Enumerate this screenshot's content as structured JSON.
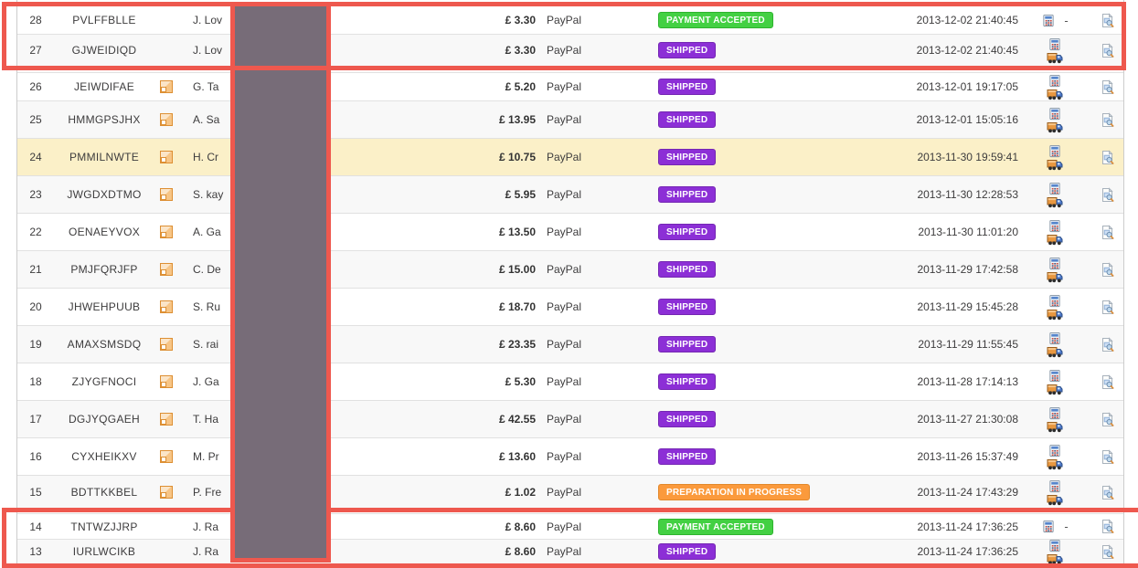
{
  "rows": [
    {
      "id": "28",
      "reference": "PVLFFBLLE",
      "new_client": false,
      "customer": "J. Lov",
      "total": "£ 3.30",
      "payment": "PayPal",
      "status": "PAYMENT ACCEPTED",
      "status_key": "accepted",
      "date": "2013-12-02 21:40:45",
      "delivery": false,
      "highlighted": false
    },
    {
      "id": "27",
      "reference": "GJWEIDIQD",
      "new_client": false,
      "customer": "J. Lov",
      "total": "£ 3.30",
      "payment": "PayPal",
      "status": "SHIPPED",
      "status_key": "shipped",
      "date": "2013-12-02 21:40:45",
      "delivery": true,
      "highlighted": false
    },
    {
      "id": "26",
      "reference": "JEIWDIFAE",
      "new_client": true,
      "customer": "G. Ta",
      "total": "£ 5.20",
      "payment": "PayPal",
      "status": "SHIPPED",
      "status_key": "shipped",
      "date": "2013-12-01 19:17:05",
      "delivery": true,
      "highlighted": false
    },
    {
      "id": "25",
      "reference": "HMMGPSJHX",
      "new_client": true,
      "customer": "A. Sa",
      "total": "£ 13.95",
      "payment": "PayPal",
      "status": "SHIPPED",
      "status_key": "shipped",
      "date": "2013-12-01 15:05:16",
      "delivery": true,
      "highlighted": false
    },
    {
      "id": "24",
      "reference": "PMMILNWTE",
      "new_client": true,
      "customer": "H. Cr",
      "total": "£ 10.75",
      "payment": "PayPal",
      "status": "SHIPPED",
      "status_key": "shipped",
      "date": "2013-11-30 19:59:41",
      "delivery": true,
      "highlighted": true
    },
    {
      "id": "23",
      "reference": "JWGDXDTMO",
      "new_client": true,
      "customer": "S. kay",
      "total": "£ 5.95",
      "payment": "PayPal",
      "status": "SHIPPED",
      "status_key": "shipped",
      "date": "2013-11-30 12:28:53",
      "delivery": true,
      "highlighted": false
    },
    {
      "id": "22",
      "reference": "OENAEYVOX",
      "new_client": true,
      "customer": "A. Ga",
      "total": "£ 13.50",
      "payment": "PayPal",
      "status": "SHIPPED",
      "status_key": "shipped",
      "date": "2013-11-30 11:01:20",
      "delivery": true,
      "highlighted": false
    },
    {
      "id": "21",
      "reference": "PMJFQRJFP",
      "new_client": true,
      "customer": "C. De",
      "total": "£ 15.00",
      "payment": "PayPal",
      "status": "SHIPPED",
      "status_key": "shipped",
      "date": "2013-11-29 17:42:58",
      "delivery": true,
      "highlighted": false
    },
    {
      "id": "20",
      "reference": "JHWEHPUUB",
      "new_client": true,
      "customer": "S. Ru",
      "total": "£ 18.70",
      "payment": "PayPal",
      "status": "SHIPPED",
      "status_key": "shipped",
      "date": "2013-11-29 15:45:28",
      "delivery": true,
      "highlighted": false
    },
    {
      "id": "19",
      "reference": "AMAXSMSDQ",
      "new_client": true,
      "customer": "S. rai",
      "total": "£ 23.35",
      "payment": "PayPal",
      "status": "SHIPPED",
      "status_key": "shipped",
      "date": "2013-11-29 11:55:45",
      "delivery": true,
      "highlighted": false
    },
    {
      "id": "18",
      "reference": "ZJYGFNOCI",
      "new_client": true,
      "customer": "J. Ga",
      "total": "£ 5.30",
      "payment": "PayPal",
      "status": "SHIPPED",
      "status_key": "shipped",
      "date": "2013-11-28 17:14:13",
      "delivery": true,
      "highlighted": false
    },
    {
      "id": "17",
      "reference": "DGJYQGAEH",
      "new_client": true,
      "customer": "T. Ha",
      "total": "£ 42.55",
      "payment": "PayPal",
      "status": "SHIPPED",
      "status_key": "shipped",
      "date": "2013-11-27 21:30:08",
      "delivery": true,
      "highlighted": false
    },
    {
      "id": "16",
      "reference": "CYXHEIKXV",
      "new_client": true,
      "customer": "M. Pr",
      "total": "£ 13.60",
      "payment": "PayPal",
      "status": "SHIPPED",
      "status_key": "shipped",
      "date": "2013-11-26 15:37:49",
      "delivery": true,
      "highlighted": false
    },
    {
      "id": "15",
      "reference": "BDTTKKBEL",
      "new_client": true,
      "customer": "P. Fre",
      "total": "£ 1.02",
      "payment": "PayPal",
      "status": "PREPARATION IN PROGRESS",
      "status_key": "preparation",
      "date": "2013-11-24 17:43:29",
      "delivery": true,
      "highlighted": false
    },
    {
      "id": "14",
      "reference": "TNTWZJJRP",
      "new_client": false,
      "customer": "J. Ra",
      "total": "£ 8.60",
      "payment": "PayPal",
      "status": "PAYMENT ACCEPTED",
      "status_key": "accepted",
      "date": "2013-11-24 17:36:25",
      "delivery": false,
      "highlighted": false
    },
    {
      "id": "13",
      "reference": "IURLWCIKB",
      "new_client": false,
      "customer": "J. Ra",
      "total": "£ 8.60",
      "payment": "PayPal",
      "status": "SHIPPED",
      "status_key": "shipped",
      "date": "2013-11-24 17:36:25",
      "delivery": true,
      "highlighted": false
    }
  ],
  "icons": {
    "no_delivery_dash": "-",
    "new_client": "new-client-icon",
    "invoice": "invoice-pdf-icon",
    "delivery": "delivery-slip-icon",
    "details": "order-details-icon"
  },
  "colors": {
    "annotation_red": "#ee584e",
    "redaction_fill": "#776c78",
    "row_alt": "#f8f8f8",
    "row_highlight": "#fbf0c8",
    "row_border": "#e1e1e1",
    "border_gray": "#cccccc",
    "text": "#3d3c3d",
    "status_accepted": "#43d043",
    "status_accepted_border": "#2eb32e",
    "status_shipped": "#8c2fd6",
    "status_shipped_border": "#7426b3",
    "status_preparation": "#fb9a3c",
    "status_preparation_border": "#e2882b"
  }
}
